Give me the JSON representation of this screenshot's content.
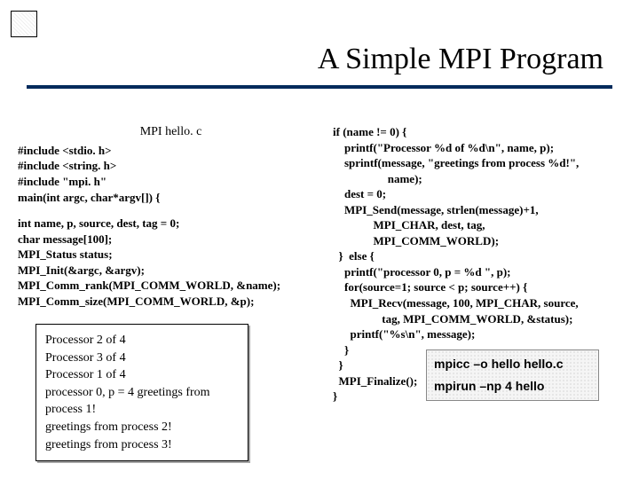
{
  "logo_text": "",
  "slide": {
    "title": "A Simple MPI Program"
  },
  "left": {
    "file_title": "MPI hello. c",
    "lines1": [
      "#include <stdio. h>",
      "#include <string. h>",
      "#include \"mpi. h\"",
      "main(int argc, char*argv[]) {"
    ],
    "lines2": [
      "int name, p, source, dest, tag = 0;",
      "char message[100];",
      "MPI_Status status;",
      "MPI_Init(&argc, &argv);",
      "MPI_Comm_rank(MPI_COMM_WORLD, &name);",
      "MPI_Comm_size(MPI_COMM_WORLD, &p);"
    ]
  },
  "right": {
    "code": "if (name != 0) {\n    printf(\"Processor %d of %d\\n\", name, p);\n    sprintf(message, \"greetings from process %d!\",\n                   name);\n    dest = 0;\n    MPI_Send(message, strlen(message)+1,\n              MPI_CHAR, dest, tag,\n              MPI_COMM_WORLD);\n  }  else {\n    printf(\"processor 0, p = %d \", p);\n    for(source=1; source < p; source++) {\n      MPI_Recv(message, 100, MPI_CHAR, source,\n                 tag, MPI_COMM_WORLD, &status);\n      printf(\"%s\\n\", message);\n    }\n  }\n  MPI_Finalize();\n}"
  },
  "output": {
    "lines": [
      "Processor 2 of 4",
      "Processor 3 of 4",
      "Processor 1 of 4",
      "processor 0, p = 4 greetings from process 1!",
      "greetings from process 2!",
      "greetings from process 3!"
    ]
  },
  "commands": {
    "compile": "mpicc –o hello hello.c",
    "run": "mpirun –np 4 hello"
  }
}
